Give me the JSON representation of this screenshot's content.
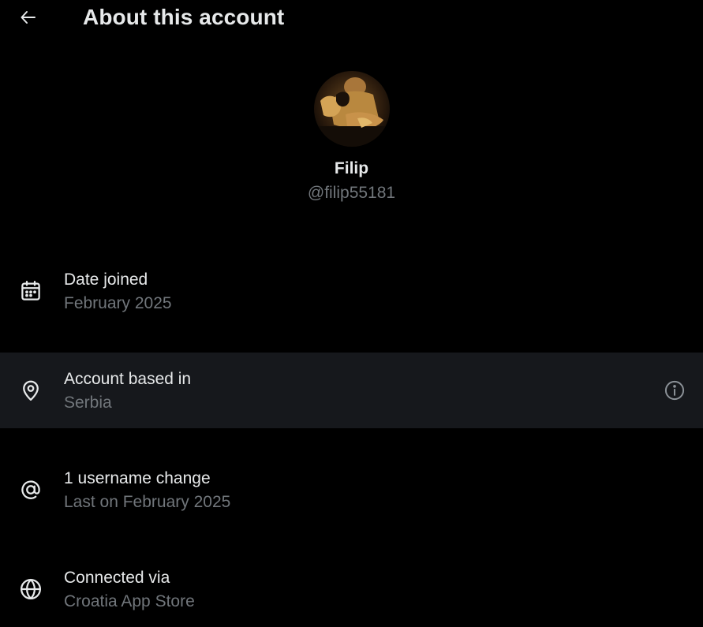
{
  "header": {
    "back_icon": "arrow-left-icon",
    "title": "About this account"
  },
  "profile": {
    "display_name": "Filip",
    "handle": "@filip55181"
  },
  "rows": [
    {
      "icon": "calendar-icon",
      "title": "Date joined",
      "subtitle": "February 2025"
    },
    {
      "icon": "location-pin-icon",
      "title": "Account based in",
      "subtitle": "Serbia",
      "trailing_icon": "info-icon"
    },
    {
      "icon": "at-sign-icon",
      "title": "1 username change",
      "subtitle": "Last on February 2025"
    },
    {
      "icon": "globe-icon",
      "title": "Connected via",
      "subtitle": "Croatia App Store"
    }
  ],
  "colors": {
    "background": "#000000",
    "primary_text": "#e7e9ea",
    "secondary_text": "#71767b",
    "highlight_row": "#16181c"
  }
}
